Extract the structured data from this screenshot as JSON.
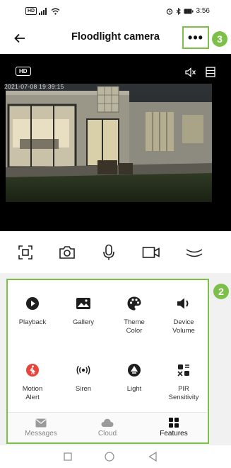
{
  "status_bar": {
    "left_icons": [
      "hd-voice-icon",
      "signal-icon",
      "wifi-icon"
    ],
    "right_icons": [
      "alarm-icon",
      "bluetooth-icon",
      "battery-icon"
    ],
    "time": "3:56"
  },
  "header": {
    "title": "Floodlight camera",
    "more_label": "•••"
  },
  "annotations": {
    "more_callout": "3",
    "panel_callout": "2",
    "color": "#7cc04a"
  },
  "video": {
    "quality_label": "HD",
    "timestamp": "2021-07-08   19:39:15"
  },
  "controls": [
    "screenshot-icon",
    "camera-icon",
    "microphone-icon",
    "record-icon",
    "collapse-icon"
  ],
  "features": [
    {
      "label": "Playback"
    },
    {
      "label": "Gallery"
    },
    {
      "label": "Theme\nColor"
    },
    {
      "label": "Device\nVolume"
    },
    {
      "label": "Motion\nAlert"
    },
    {
      "label": "Siren"
    },
    {
      "label": "Light"
    },
    {
      "label": "PIR\nSensitivity"
    }
  ],
  "tabs": [
    {
      "label": "Messages"
    },
    {
      "label": "Cloud"
    },
    {
      "label": "Features"
    }
  ]
}
